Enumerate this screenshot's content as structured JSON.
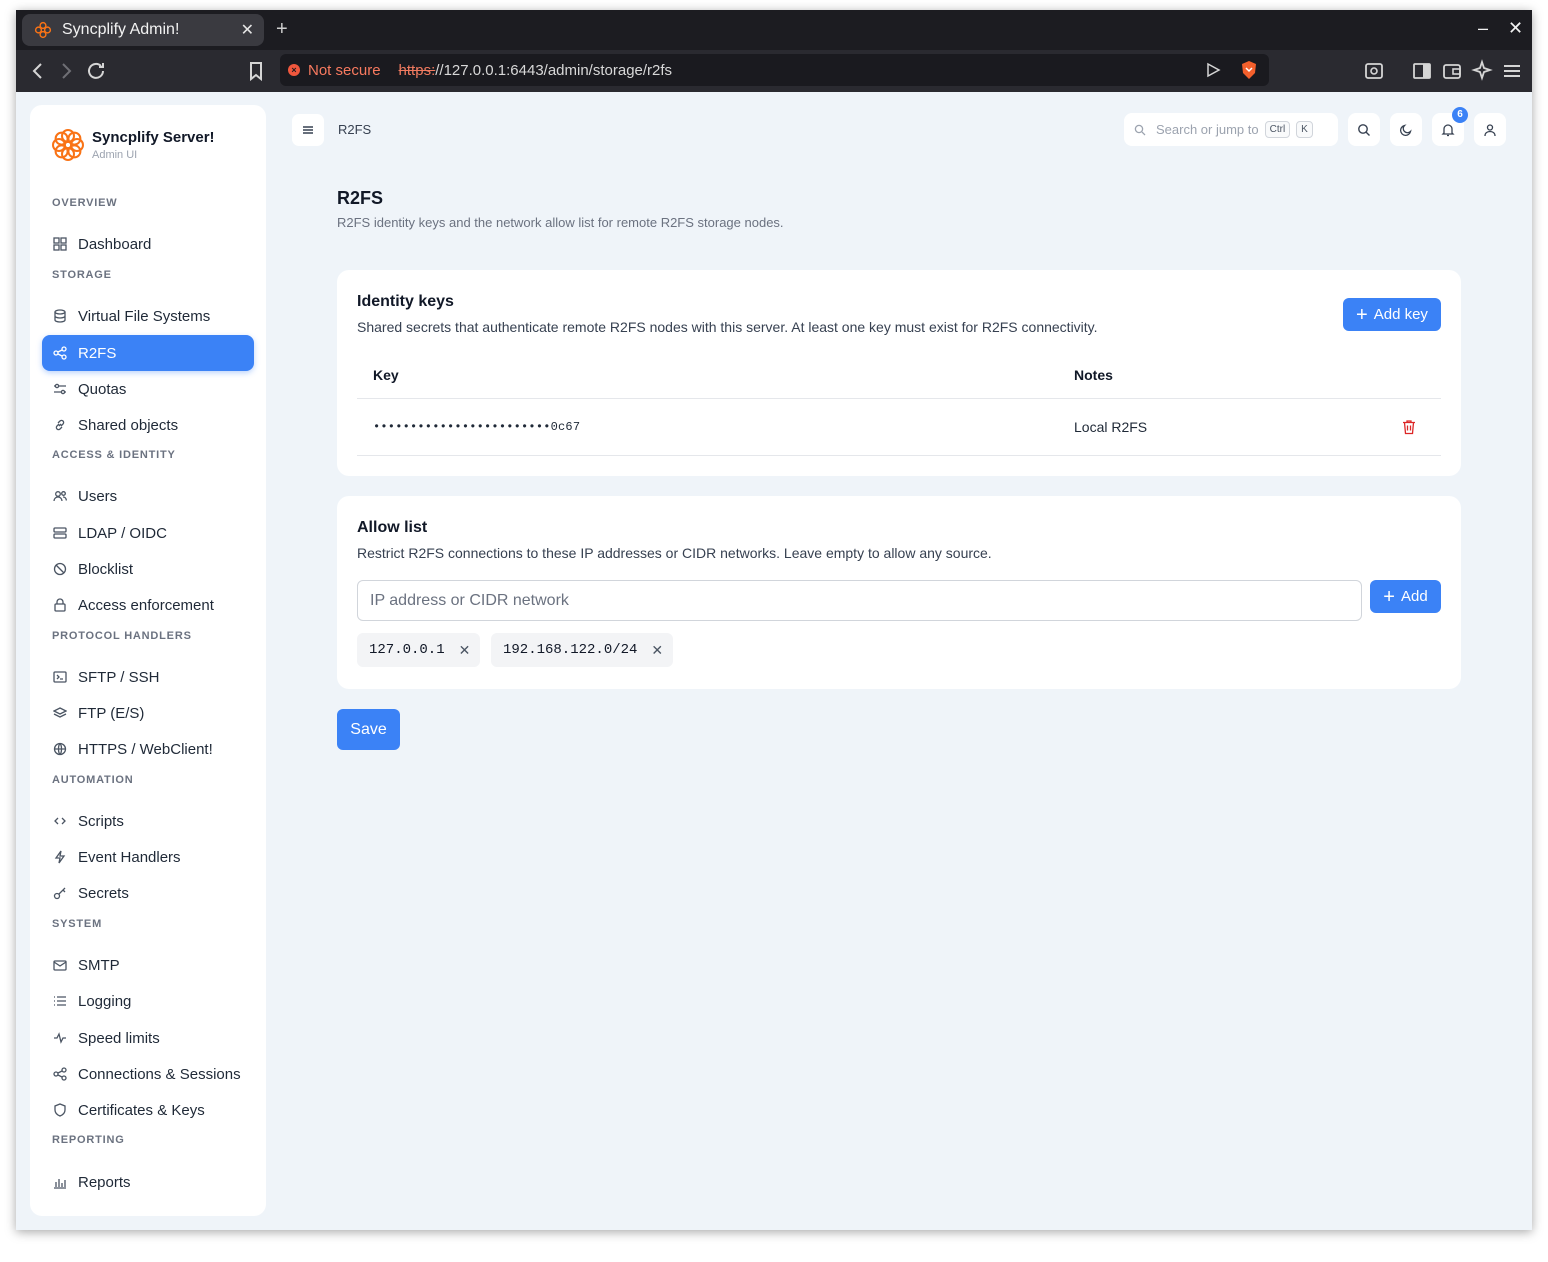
{
  "browser": {
    "tab_title": "Syncplify Admin!",
    "not_secure": "Not secure",
    "url_scheme": "https:",
    "url_rest": "//127.0.0.1:6443/admin/storage/r2fs"
  },
  "brand": {
    "title": "Syncplify Server!",
    "subtitle": "Admin UI",
    "accent": "#f97316"
  },
  "sidebar": {
    "sections": {
      "overview": "OVERVIEW",
      "storage": "STORAGE",
      "access": "ACCESS & IDENTITY",
      "protocol": "PROTOCOL HANDLERS",
      "automation": "AUTOMATION",
      "system": "SYSTEM",
      "reporting": "REPORTING"
    },
    "items": [
      {
        "label": "Dashboard",
        "icon": "grid-icon"
      },
      {
        "label": "Virtual File Systems",
        "icon": "database-icon"
      },
      {
        "label": "R2FS",
        "icon": "share-icon"
      },
      {
        "label": "Quotas",
        "icon": "sliders-icon"
      },
      {
        "label": "Shared objects",
        "icon": "link-icon"
      },
      {
        "label": "Users",
        "icon": "users-icon"
      },
      {
        "label": "LDAP / OIDC",
        "icon": "server-icon"
      },
      {
        "label": "Blocklist",
        "icon": "ban-icon"
      },
      {
        "label": "Access enforcement",
        "icon": "lock-icon"
      },
      {
        "label": "SFTP / SSH",
        "icon": "terminal-icon"
      },
      {
        "label": "FTP (E/S)",
        "icon": "layers-icon"
      },
      {
        "label": "HTTPS / WebClient!",
        "icon": "globe-icon"
      },
      {
        "label": "Scripts",
        "icon": "code-icon"
      },
      {
        "label": "Event Handlers",
        "icon": "bolt-icon"
      },
      {
        "label": "Secrets",
        "icon": "key-icon"
      },
      {
        "label": "SMTP",
        "icon": "mail-icon"
      },
      {
        "label": "Logging",
        "icon": "list-icon"
      },
      {
        "label": "Speed limits",
        "icon": "activity-icon"
      },
      {
        "label": "Connections & Sessions",
        "icon": "share-icon"
      },
      {
        "label": "Certificates & Keys",
        "icon": "shield-icon"
      },
      {
        "label": "Reports",
        "icon": "bar-chart-icon"
      }
    ],
    "active": "R2FS"
  },
  "header": {
    "breadcrumb": "R2FS",
    "search_placeholder": "Search or jump to",
    "kbd_ctrl": "Ctrl",
    "kbd_k": "K",
    "notification_count": "6"
  },
  "page": {
    "title": "R2FS",
    "subtitle": "R2FS identity keys and the network allow list for remote R2FS storage nodes."
  },
  "identity_keys": {
    "title": "Identity keys",
    "description": "Shared secrets that authenticate remote R2FS nodes with this server. At least one key must exist for R2FS connectivity.",
    "add_label": "Add key",
    "columns": [
      "Key",
      "Notes"
    ],
    "rows": [
      {
        "key": "••••••••••••••••••••••••0c67",
        "notes": "Local R2FS"
      }
    ]
  },
  "allow_list": {
    "title": "Allow list",
    "description": "Restrict R2FS connections to these IP addresses or CIDR networks. Leave empty to allow any source.",
    "input_placeholder": "IP address or CIDR network",
    "add_label": "Add",
    "entries": [
      "127.0.0.1",
      "192.168.122.0/24"
    ]
  },
  "save_label": "Save",
  "colors": {
    "primary": "#3b82f6",
    "danger": "#dc2626",
    "background": "#eff4f9"
  }
}
